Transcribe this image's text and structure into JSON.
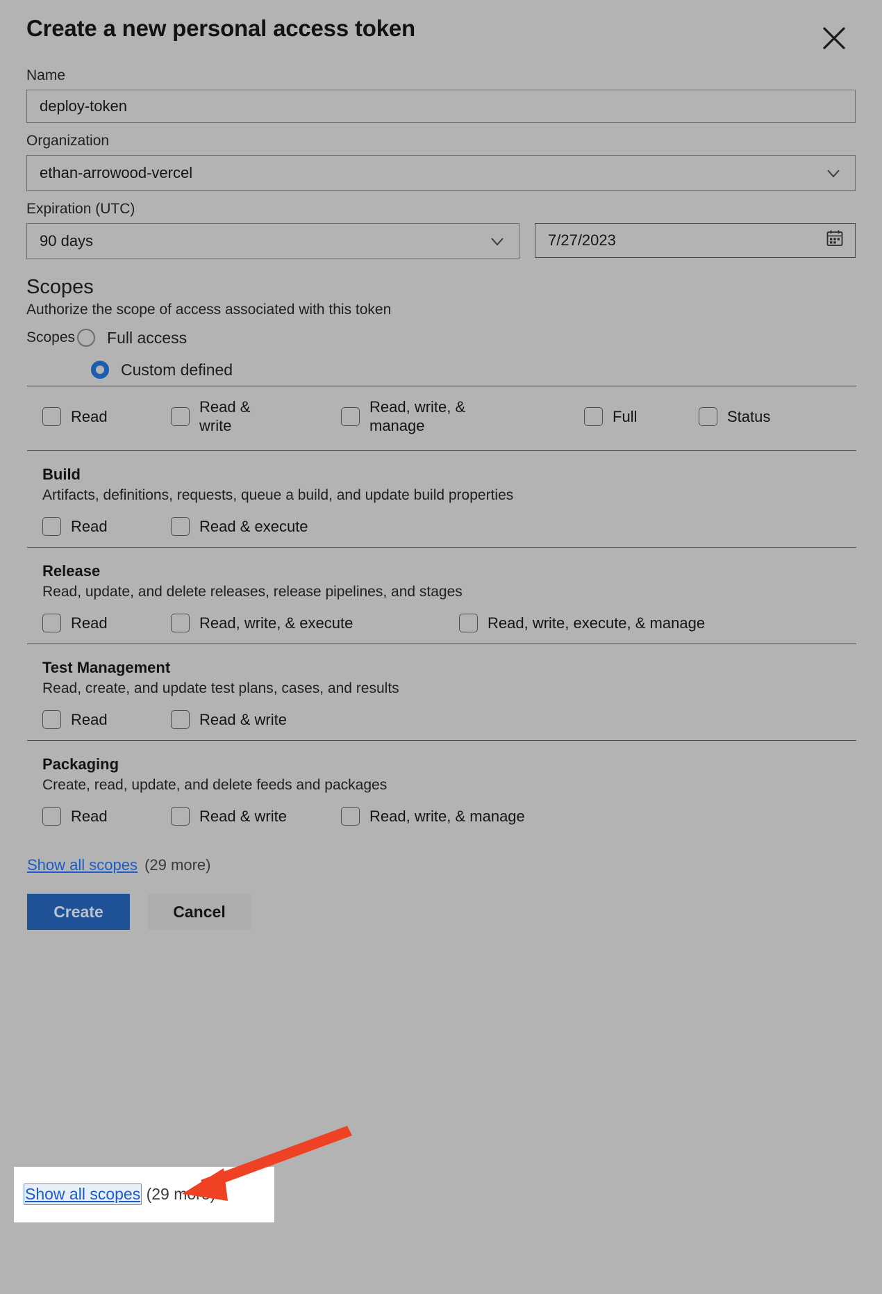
{
  "dialog": {
    "title": "Create a new personal access token",
    "close_icon": "close-icon"
  },
  "form": {
    "name": {
      "label": "Name",
      "value": "deploy-token",
      "placeholder": "Token name"
    },
    "organization": {
      "label": "Organization",
      "value": "ethan-arrowood-vercel"
    },
    "expiration": {
      "label": "Expiration (UTC)",
      "preset_value": "90 days",
      "date_value": "7/27/2023"
    }
  },
  "scopes": {
    "heading": "Scopes",
    "description": "Authorize the scope of access associated with this token",
    "radio_inline_label": "Scopes",
    "options": [
      {
        "label": "Full access",
        "checked": false
      },
      {
        "label": "Custom defined",
        "checked": true
      }
    ],
    "sections": [
      {
        "name": "",
        "desc": "",
        "is_header_row": true,
        "checkboxes": [
          {
            "label": "Read",
            "checked": false
          },
          {
            "label": "Read & write",
            "checked": false
          },
          {
            "label": "Read, write, & manage",
            "checked": false
          },
          {
            "label": "Full",
            "checked": false
          },
          {
            "label": "Status",
            "checked": false
          }
        ]
      },
      {
        "name": "Build",
        "desc": "Artifacts, definitions, requests, queue a build, and update build properties",
        "is_header_row": false,
        "checkboxes": [
          {
            "label": "Read",
            "checked": false
          },
          {
            "label": "Read & execute",
            "checked": false
          }
        ]
      },
      {
        "name": "Release",
        "desc": "Read, update, and delete releases, release pipelines, and stages",
        "is_header_row": false,
        "checkboxes": [
          {
            "label": "Read",
            "checked": false
          },
          {
            "label": "Read, write, & execute",
            "checked": false
          },
          {
            "label": "Read, write, execute, & manage",
            "checked": false
          }
        ]
      },
      {
        "name": "Test Management",
        "desc": "Read, create, and update test plans, cases, and results",
        "is_header_row": false,
        "checkboxes": [
          {
            "label": "Read",
            "checked": false
          },
          {
            "label": "Read & write",
            "checked": false
          }
        ]
      },
      {
        "name": "Packaging",
        "desc": "Create, read, update, and delete feeds and packages",
        "is_header_row": false,
        "checkboxes": [
          {
            "label": "Read",
            "checked": false
          },
          {
            "label": "Read & write",
            "checked": false
          },
          {
            "label": "Read, write, & manage",
            "checked": false
          }
        ]
      }
    ],
    "show_all": {
      "link_label": "Show all scopes",
      "more_label": "(29 more)"
    }
  },
  "footer": {
    "create_label": "Create",
    "cancel_label": "Cancel"
  },
  "annotation": {
    "link_label": "Show all scopes",
    "more_label": "(29 more)",
    "arrow_color": "#ef4123",
    "highlight_bg": "#ffffff"
  },
  "colors": {
    "page_bg": "#b3b3b3",
    "accent_blue": "#1b5daf",
    "link_blue": "#1a5dc8",
    "primary_button": "#1f5196",
    "arrow_red": "#ef4123"
  }
}
